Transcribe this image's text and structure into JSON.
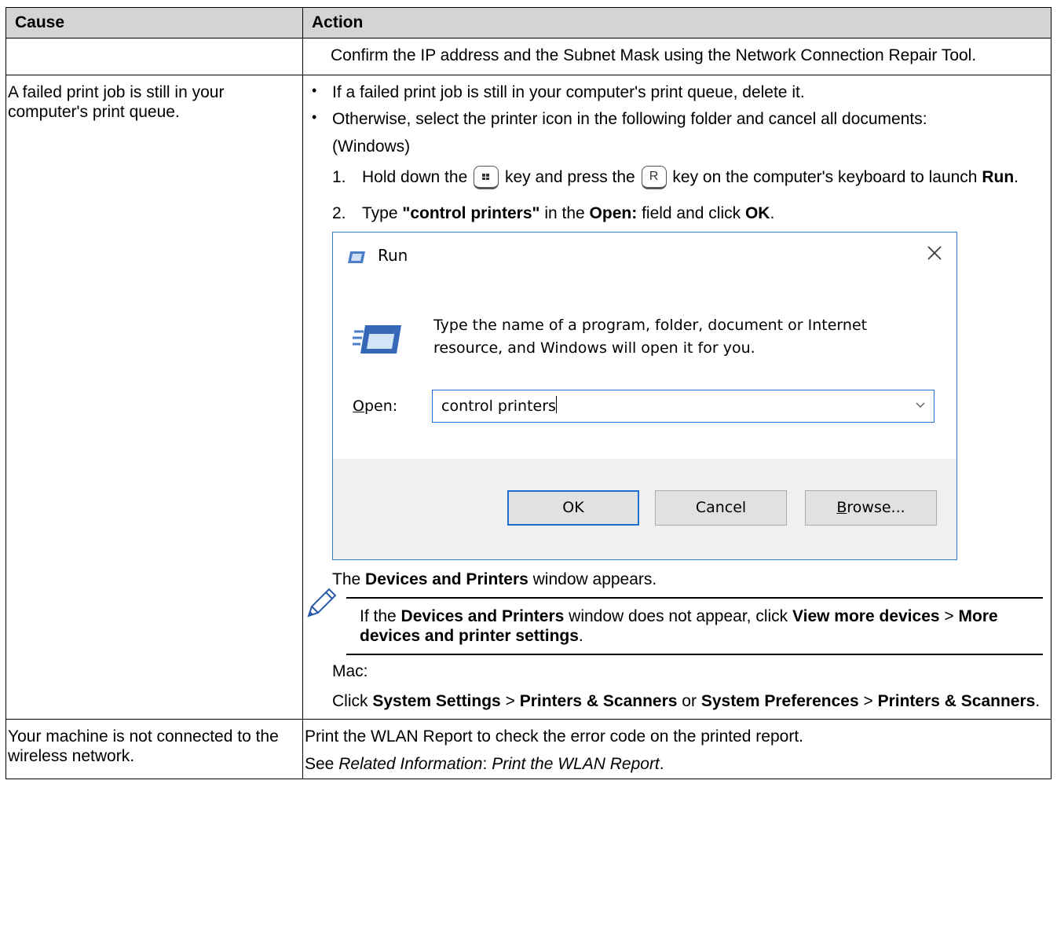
{
  "table": {
    "header": {
      "cause": "Cause",
      "action": "Action"
    },
    "row1": {
      "action": "Confirm the IP address and the Subnet Mask using the Network Connection Repair Tool."
    },
    "row2": {
      "cause": "A failed print job is still in your computer's print queue.",
      "bullet1": "If a failed print job is still in your computer's print queue, delete it.",
      "bullet2": "Otherwise, select the printer icon in the following folder and cancel all documents:",
      "windows_label": "(Windows)",
      "step1": {
        "num": "1.",
        "part1": "Hold down the",
        "key_win_icon": "windows-key-icon",
        "part2": "key and press the",
        "key_r": "R",
        "part3": "key on the computer's keyboard to launch",
        "run_word": "Run",
        "end": "."
      },
      "step2": {
        "num": "2.",
        "part1": "Type",
        "cmd": "\"control printers\"",
        "part2": "in the",
        "open_field": "Open:",
        "part3": "field and click",
        "ok": "OK",
        "end": "."
      },
      "run_dialog": {
        "title": "Run",
        "description": "Type the name of a program, folder, document or Internet resource, and Windows will open it for you.",
        "open_label_underlined": "O",
        "open_label_rest": "pen:",
        "input_value": "control printers",
        "ok_button": "OK",
        "cancel_button": "Cancel",
        "browse_underlined": "B",
        "browse_rest": "rowse...",
        "accent_color": "#1f6fd0"
      },
      "after_dialog": {
        "part1": "The",
        "bold": "Devices and Printers",
        "part2": "window appears."
      },
      "note": {
        "icon": "pencil-note-icon",
        "part1": "If the",
        "bold1": "Devices and Printers",
        "part2": "window does not appear, click",
        "bold2": "View more devices",
        "sep": ">",
        "bold3": "More devices and printer settings",
        "end": "."
      },
      "mac_label": "Mac:",
      "mac": {
        "part1": "Click",
        "bold1": "System Settings",
        "sep1": ">",
        "bold2": "Printers & Scanners",
        "or": "or",
        "bold3": "System Preferences",
        "sep2": ">",
        "bold4": "Printers & Scanners",
        "end": "."
      }
    },
    "row3": {
      "cause": "Your machine is not connected to the wireless network.",
      "line1": "Print the WLAN Report to check the error code on the printed report.",
      "see": "See",
      "related": "Related Information",
      "colon": ":",
      "link": "Print the WLAN Report",
      "end": "."
    }
  }
}
